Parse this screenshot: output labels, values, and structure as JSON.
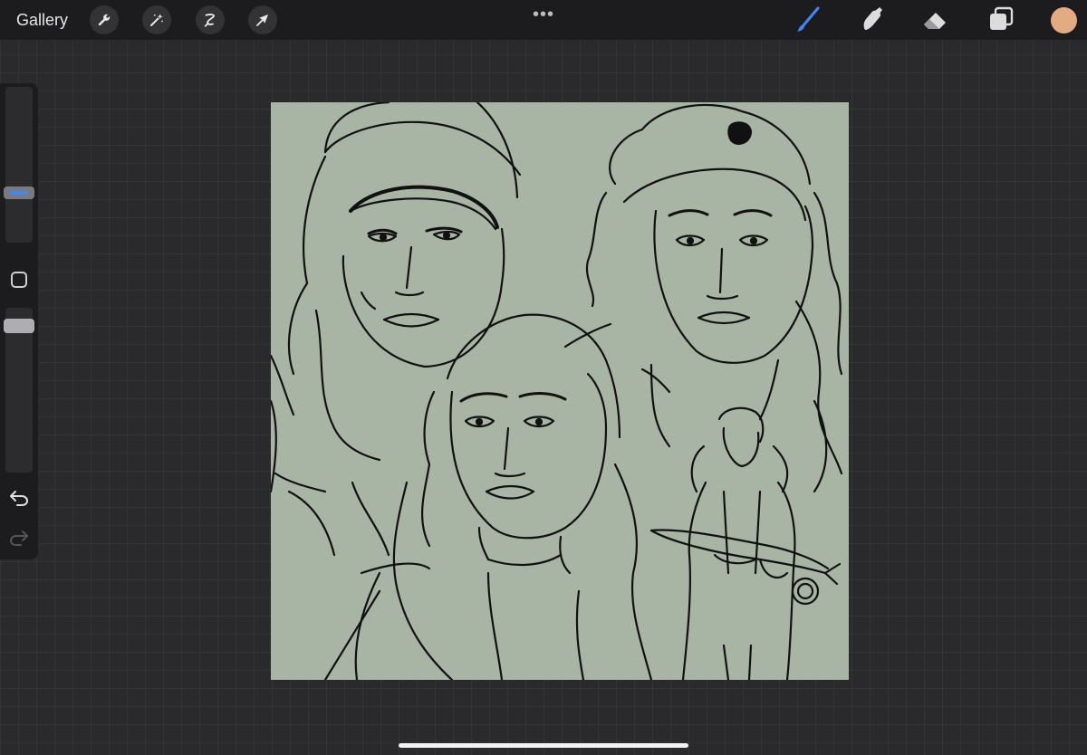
{
  "topbar": {
    "gallery_label": "Gallery",
    "left_tools": [
      "wrench-icon",
      "magic-wand-icon",
      "selection-icon",
      "transform-arrow-icon"
    ],
    "more_dots": "•••",
    "right_tools": [
      "brush-icon",
      "smudge-icon",
      "eraser-icon",
      "layers-icon"
    ],
    "active_tool": "brush",
    "active_tool_color": "#3f87ff",
    "current_color": "#e2ab82"
  },
  "sidebar": {
    "controls": [
      "brush-size-slider",
      "modify-button",
      "opacity-slider",
      "undo-icon",
      "redo-icon"
    ]
  },
  "canvas": {
    "background_color": "#a8b5a4",
    "content": "line-art-portrait-sketch"
  }
}
